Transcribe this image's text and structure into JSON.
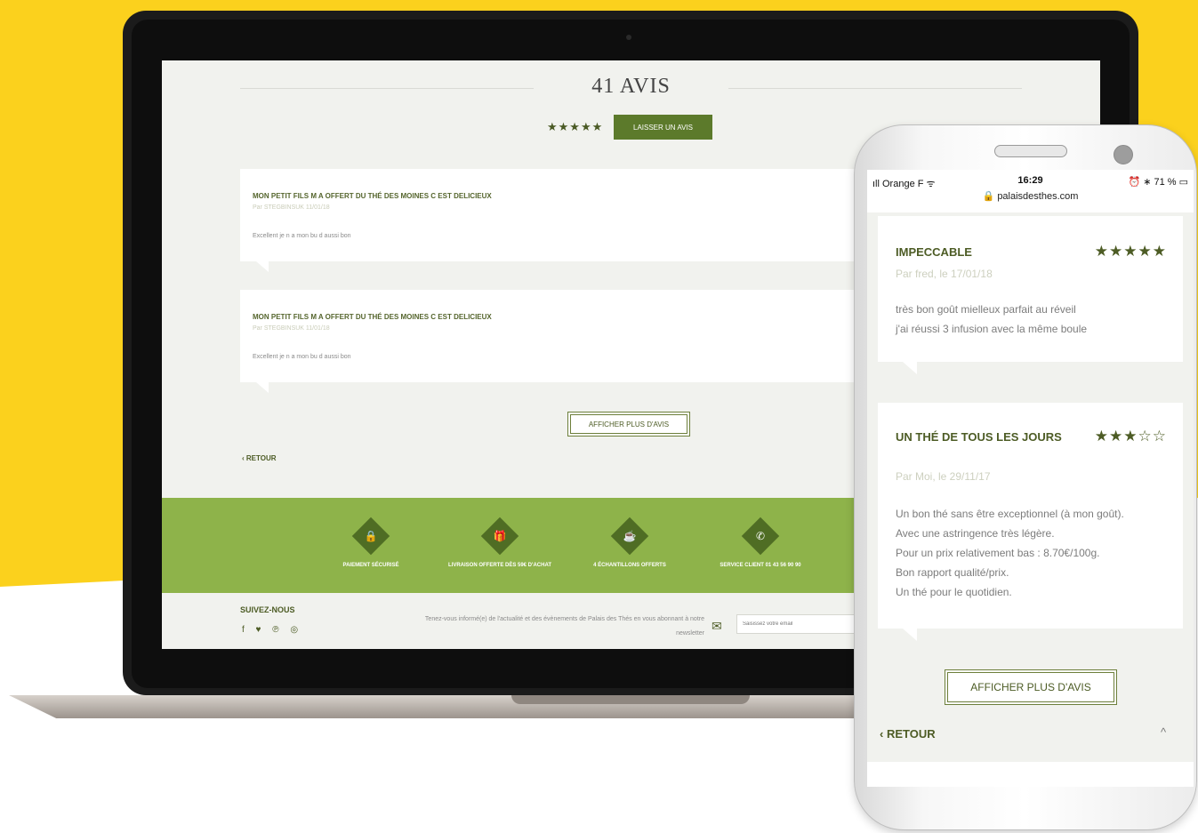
{
  "desktop": {
    "heading": "41 AVIS",
    "stars": "★★★★★",
    "leave_review_label": "LAISSER UN AVIS",
    "reviews": [
      {
        "title": "MON PETIT FILS M A OFFERT DU THÉ DES MOINES C EST DELICIEUX",
        "meta": "Par STEGBINSUK 11/01/18",
        "body": "Excellent je n a mon bu d aussi bon"
      },
      {
        "title": "MON PETIT FILS M A OFFERT DU THÉ DES MOINES C EST DELICIEUX",
        "meta": "Par STEGBINSUK 11/01/18",
        "body": "Excellent je n a mon bu d aussi bon"
      }
    ],
    "more_label": "AFFICHER PLUS D'AVIS",
    "back_label": "RETOUR",
    "features": [
      {
        "icon": "lock-icon",
        "glyph": "🔒",
        "label": "PAIEMENT SÉCURISÉ"
      },
      {
        "icon": "gift-icon",
        "glyph": "🎁",
        "label": "LIVRAISON OFFERTE DÈS 59€ D'ACHAT"
      },
      {
        "icon": "cup-icon",
        "glyph": "☕",
        "label": "4 ÉCHANTILLONS OFFERTS"
      },
      {
        "icon": "phone-icon",
        "glyph": "✆",
        "label": "SERVICE CLIENT 01 43 56 90 90"
      }
    ],
    "follow_label": "SUIVEZ-NOUS",
    "socials": "f ♥ ℗ ◎",
    "newsletter_text": "Tenez-vous informé(e) de l'actualité et des évènements de Palais des Thés en vous abonnant à notre newsletter",
    "email_placeholder": "Saisissez votre email"
  },
  "phone": {
    "carrier": "ıll Orange F ᯤ",
    "time": "16:29",
    "battery": "⏰ ∗ 71 % ▭",
    "url": "🔒 palaisdesthes.com",
    "reviews": [
      {
        "title": "IMPECCABLE",
        "stars": "★★★★★",
        "meta": "Par fred, le 17/01/18",
        "body": [
          "très bon goût mielleux parfait au réveil",
          "j'ai réussi 3 infusion avec la même boule"
        ]
      },
      {
        "title": "UN THÉ DE TOUS LES JOURS",
        "stars": "★★★☆☆",
        "meta": "Par Moi, le 29/11/17",
        "body": [
          "Un bon thé sans être exceptionnel (à mon goût).",
          "Avec une astringence très légère.",
          "Pour un prix relativement bas : 8.70€/100g.",
          "Bon rapport qualité/prix.",
          "Un thé pour le quotidien."
        ]
      }
    ],
    "more_label": "AFFICHER PLUS D'AVIS",
    "back_label": "‹ RETOUR",
    "up_glyph": "^"
  },
  "colors": {
    "yellow": "#fbd11d",
    "brand_green": "#5c7a2b",
    "band_green": "#8eb34a",
    "text_green": "#4d5c25"
  }
}
